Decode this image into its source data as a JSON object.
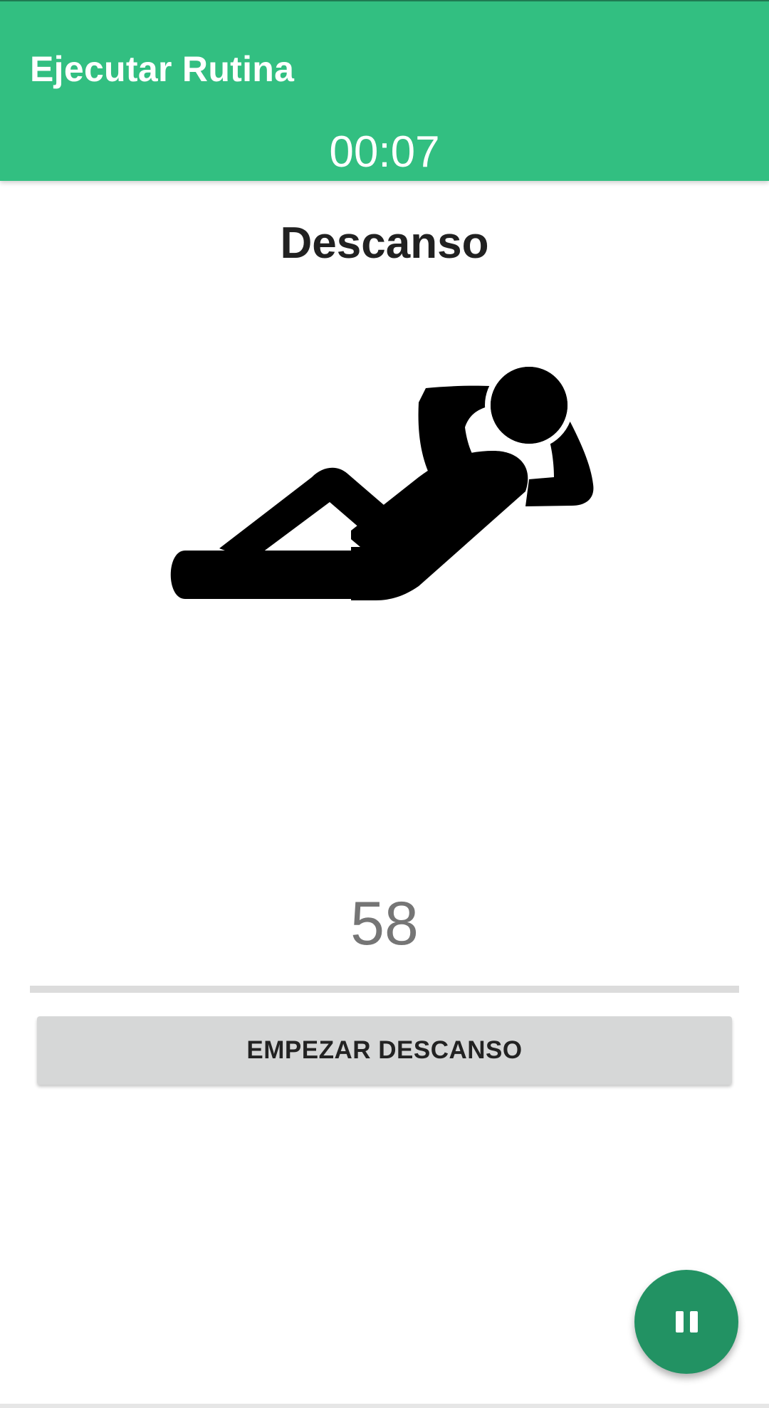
{
  "app_bar": {
    "title": "Ejecutar Rutina",
    "timer": "00:07",
    "color": "#32bf81"
  },
  "exercise": {
    "name": "Descanso",
    "illustration_icon": "crunch-figure-icon",
    "counter": "58",
    "progress_fraction": 0
  },
  "actions": {
    "start_rest_label": "EMPEZAR DESCANSO",
    "pause_icon": "pause-icon",
    "fab_color": "#229263"
  }
}
